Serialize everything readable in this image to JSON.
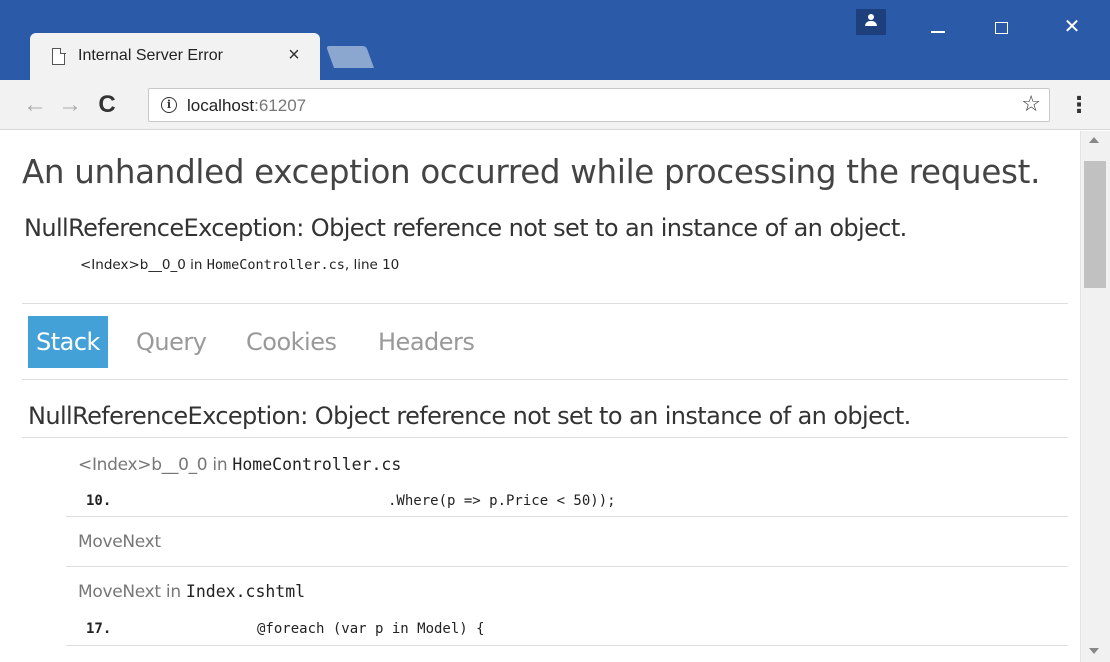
{
  "browser": {
    "tab": {
      "title": "Internal Server Error",
      "close_glyph": "×"
    },
    "window_controls": {
      "close_glyph": "✕"
    },
    "address": {
      "host": "localhost",
      "port": ":61207"
    },
    "nav": {
      "back_glyph": "←",
      "forward_glyph": "→",
      "reload_glyph": "C",
      "star_glyph": "☆",
      "menu_glyph": "⋮",
      "info_glyph": "i"
    },
    "colors": {
      "titlebar": "#2b5ba8",
      "active_tab_bg": "#44a1d8"
    }
  },
  "page": {
    "heading": "An unhandled exception occurred while processing the request.",
    "exception": "NullReferenceException: Object reference not set to an instance of an object.",
    "location": {
      "method": "<Index>b__0_0 in ",
      "file": "HomeController.cs",
      "line": ", line 10"
    },
    "tabs": [
      {
        "label": "Stack",
        "active": true
      },
      {
        "label": "Query",
        "active": false
      },
      {
        "label": "Cookies",
        "active": false
      },
      {
        "label": "Headers",
        "active": false
      }
    ],
    "stack": {
      "title": "NullReferenceException: Object reference not set to an instance of an object.",
      "frames": [
        {
          "method": "<Index>b__0_0 in ",
          "file": "HomeController.cs",
          "line_no": "10.",
          "code": ".Where(p => p.Price < 50));"
        },
        {
          "method": "MoveNext",
          "file": ""
        },
        {
          "method": "MoveNext in ",
          "file": "Index.cshtml",
          "line_no": "17.",
          "code": "@foreach (var p in Model) {"
        }
      ]
    }
  }
}
